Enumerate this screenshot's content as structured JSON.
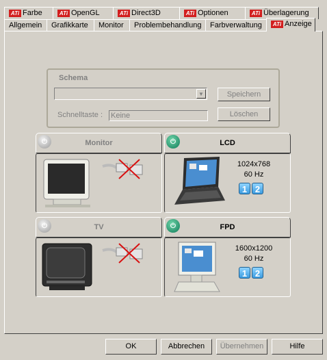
{
  "tabs_row1": [
    {
      "label": "Farbe",
      "ati": true
    },
    {
      "label": "OpenGL",
      "ati": true
    },
    {
      "label": "Direct3D",
      "ati": true
    },
    {
      "label": "Optionen",
      "ati": true
    },
    {
      "label": "Überlagerung",
      "ati": true
    }
  ],
  "tabs_row2": [
    {
      "label": "Allgemein"
    },
    {
      "label": "Grafikkarte"
    },
    {
      "label": "Monitor"
    },
    {
      "label": "Problembehandlung"
    },
    {
      "label": "Farbverwaltung"
    },
    {
      "label": "Anzeige",
      "ati": true,
      "active": true
    }
  ],
  "ati_logo_text": "ATi",
  "schema": {
    "title": "Schema",
    "combo_value": "",
    "save_label": "Speichern",
    "hotkey_label": "Schnelltaste :",
    "hotkey_value": "Keine",
    "delete_label": "Löschen"
  },
  "devices": {
    "monitor": {
      "label": "Monitor",
      "enabled": false
    },
    "lcd": {
      "label": "LCD",
      "enabled": true,
      "resolution": "1024x768",
      "refresh": "60 Hz",
      "display_buttons": [
        "1",
        "2"
      ]
    },
    "tv": {
      "label": "TV",
      "enabled": false
    },
    "fpd": {
      "label": "FPD",
      "enabled": true,
      "resolution": "1600x1200",
      "refresh": "60 Hz",
      "display_buttons": [
        "1",
        "2"
      ]
    }
  },
  "buttons": {
    "ok": "OK",
    "cancel": "Abbrechen",
    "apply": "Übernehmen",
    "help": "Hilfe"
  },
  "colors": {
    "ati_red": "#d21f1f",
    "toggle_on": "#1a9a6e",
    "toggle_off": "#b0b0b0",
    "display_button": "#3b9be0"
  }
}
